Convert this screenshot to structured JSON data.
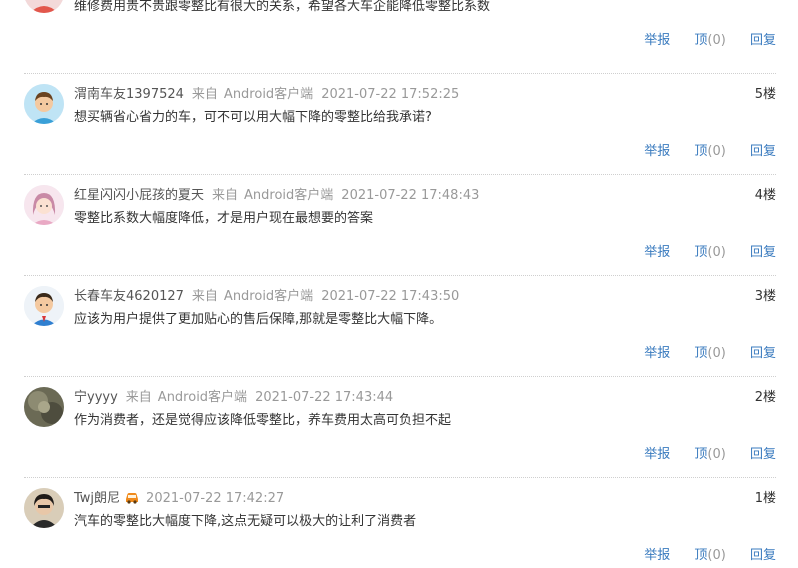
{
  "comments": [
    {
      "text": "维修费用贵不贵跟零整比有很大的关系，希望各大车企能降低零整比系数",
      "actions": {
        "report": "举报",
        "like": "顶",
        "like_count": "(0)",
        "reply": "回复"
      }
    },
    {
      "user": "渭南车友1397524",
      "from": "来自",
      "client": "Android客户端",
      "time": "2021-07-22 17:52:25",
      "floor": "5楼",
      "text": "想买辆省心省力的车，可不可以用大幅下降的零整比给我承诺?",
      "actions": {
        "report": "举报",
        "like": "顶",
        "like_count": "(0)",
        "reply": "回复"
      }
    },
    {
      "user": "红星闪闪小屁孩的夏天",
      "from": "来自",
      "client": "Android客户端",
      "time": "2021-07-22 17:48:43",
      "floor": "4楼",
      "text": "零整比系数大幅度降低，才是用户现在最想要的答案",
      "actions": {
        "report": "举报",
        "like": "顶",
        "like_count": "(0)",
        "reply": "回复"
      }
    },
    {
      "user": "长春车友4620127",
      "from": "来自",
      "client": "Android客户端",
      "time": "2021-07-22 17:43:50",
      "floor": "3楼",
      "text": "应该为用户提供了更加贴心的售后保障,那就是零整比大幅下降。",
      "actions": {
        "report": "举报",
        "like": "顶",
        "like_count": "(0)",
        "reply": "回复"
      }
    },
    {
      "user": "宁yyyy",
      "from": "来自",
      "client": "Android客户端",
      "time": "2021-07-22 17:43:44",
      "floor": "2楼",
      "text": "作为消费者，还是觉得应该降低零整比，养车费用太高可负担不起",
      "actions": {
        "report": "举报",
        "like": "顶",
        "like_count": "(0)",
        "reply": "回复"
      }
    },
    {
      "user": "Twj朗尼",
      "badge_icon": "car-owner-badge-icon",
      "time": "2021-07-22 17:42:27",
      "floor": "1楼",
      "text": "汽车的零整比大幅度下降,这点无疑可以极大的让利了消费者",
      "actions": {
        "report": "举报",
        "like": "顶",
        "like_count": "(0)",
        "reply": "回复"
      }
    }
  ],
  "colors": {
    "link": "#3a7bbf",
    "meta": "#999999",
    "text": "#333333",
    "divider": "#cfcfcf"
  }
}
